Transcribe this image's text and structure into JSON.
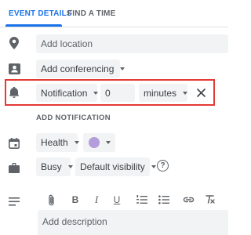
{
  "tabs": {
    "details": "EVENT DETAILS",
    "find_time": "FIND A TIME"
  },
  "location": {
    "placeholder": "Add location"
  },
  "conferencing": {
    "label": "Add conferencing"
  },
  "notification": {
    "type": "Notification",
    "amount": "0",
    "unit": "minutes",
    "remove_icon": "close-icon"
  },
  "add_notification_label": "ADD NOTIFICATION",
  "calendar": {
    "name": "Health",
    "color": "#b39ddb"
  },
  "availability": {
    "status": "Busy",
    "visibility": "Default visibility",
    "help": "?"
  },
  "editor": {
    "tools": [
      "attach-icon",
      "bold-icon",
      "italic-icon",
      "underline-icon",
      "numbered-list-icon",
      "bulleted-list-icon",
      "link-icon",
      "clear-format-icon"
    ],
    "bold": "B",
    "italic": "I",
    "underline": "U",
    "placeholder": "Add description"
  },
  "colors": {
    "accent": "#1a73e8",
    "highlight": "#e53935",
    "field_bg": "#f1f3f4"
  }
}
